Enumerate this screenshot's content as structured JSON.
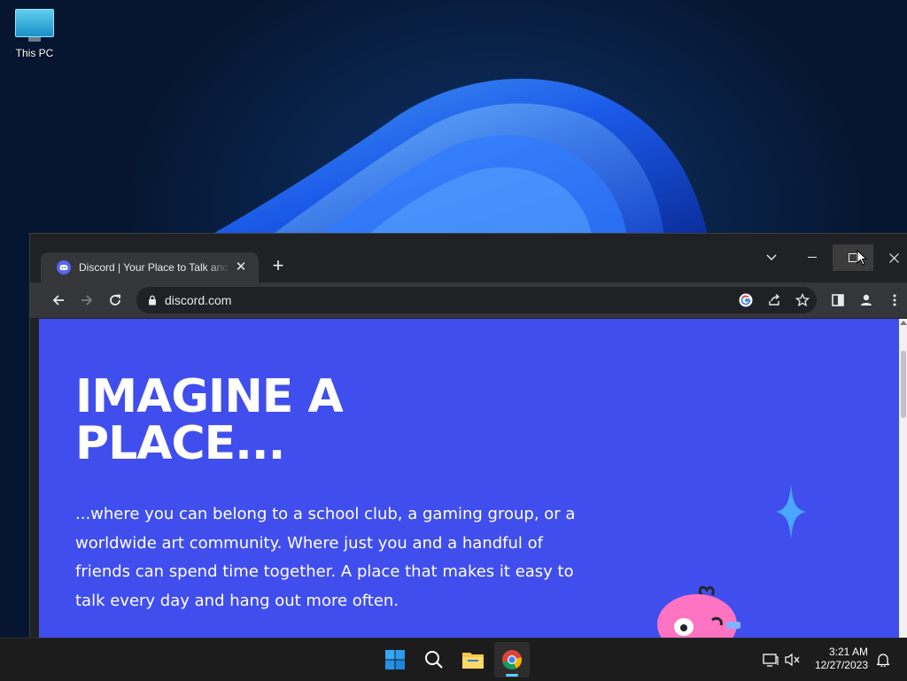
{
  "desktop": {
    "icons": [
      {
        "label": "This PC",
        "icon": "this-pc-icon"
      }
    ]
  },
  "browser": {
    "tab": {
      "title": "Discord | Your Place to Talk and Hang Out",
      "favicon": "discord-icon"
    },
    "new_tab_icon": "plus-icon",
    "window_controls": [
      "tab-search-icon",
      "minimize-icon",
      "maximize-icon",
      "close-icon"
    ],
    "nav": [
      "back-icon",
      "forward-icon",
      "reload-icon"
    ],
    "address_bar": {
      "url": "discord.com",
      "icon": "lock-icon"
    },
    "omnibox_actions": [
      "google-icon",
      "share-icon",
      "bookmark-star-icon"
    ],
    "toolbar_actions": [
      "side-panel-icon",
      "profile-icon",
      "menu-icon"
    ]
  },
  "page": {
    "hero_title_line1": "IMAGINE A",
    "hero_title_line2": "PLACE...",
    "hero_text": "...where you can belong to a school club, a gaming group, or a worldwide art community. Where just you and a handful of friends can spend time together. A place that makes it easy to talk every day and hang out more often.",
    "background_color": "#404eed"
  },
  "taskbar": {
    "apps": [
      "start-icon",
      "search-icon",
      "file-explorer-icon",
      "chrome-icon"
    ],
    "active_app": "chrome-icon",
    "tray": [
      "network-icon",
      "volume-muted-icon"
    ],
    "time": "3:21 AM",
    "date": "12/27/2023",
    "notification_icon": "bell-icon"
  }
}
